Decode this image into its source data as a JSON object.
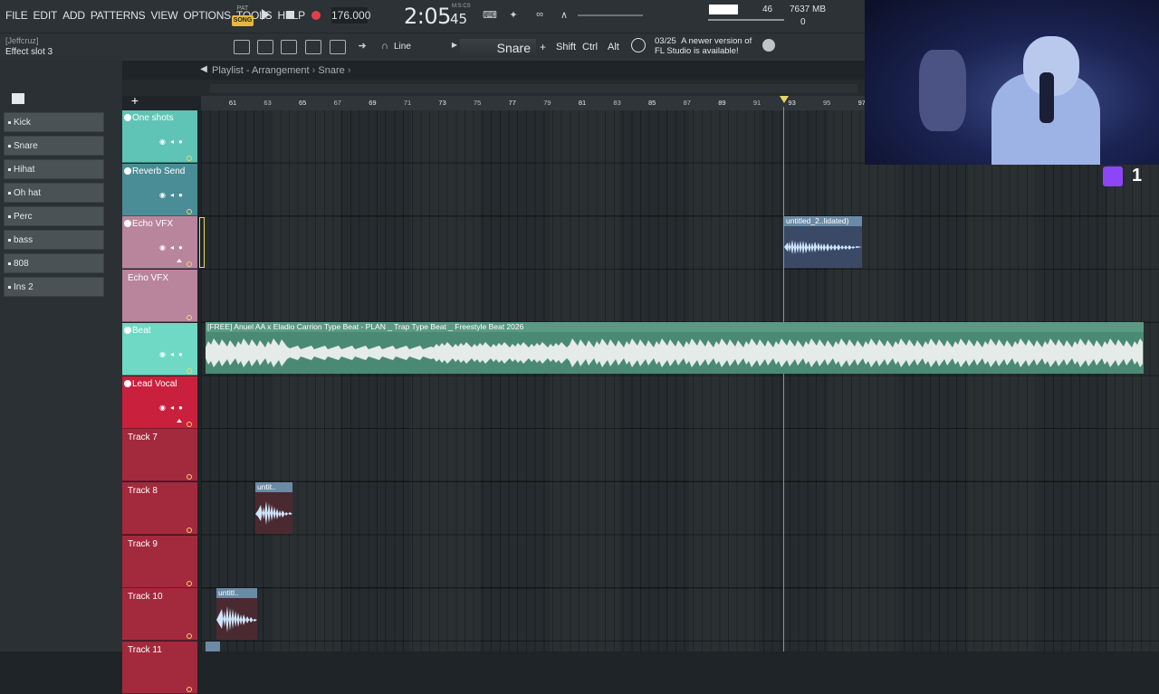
{
  "menu": [
    "FILE",
    "EDIT",
    "ADD",
    "PATTERNS",
    "VIEW",
    "OPTIONS",
    "TOOLS",
    "HELP"
  ],
  "transport": {
    "pat_label": "PAT",
    "song_label": "SONG",
    "bpm": "176.000",
    "time_main": "2:05",
    "time_sub": "45",
    "time_format": "M:S:CS"
  },
  "status": {
    "cpu": "46",
    "memory": "7637 MB",
    "polyphony": "0"
  },
  "hint": {
    "user": "[Jeffcruz]",
    "text": "Effect slot 3"
  },
  "toolbar": {
    "snap_mode": "Line",
    "snap_value": "Snare",
    "plus": "+",
    "shift": "Shift",
    "ctrl": "Ctrl",
    "alt": "Alt",
    "news_date": "03/25",
    "news_line1": "A newer version of",
    "news_line2": "FL Studio is available!"
  },
  "playlist": {
    "title": "Playlist - Arrangement",
    "pattern": "Snare"
  },
  "channels": [
    "Kick",
    "Snare",
    "Hihat",
    "Oh hat",
    "Perc",
    "bass",
    "808",
    "Ins 2"
  ],
  "ruler_ticks": [
    "61",
    "63",
    "65",
    "67",
    "69",
    "71",
    "73",
    "75",
    "77",
    "79",
    "81",
    "83",
    "85",
    "87",
    "89",
    "91",
    "93",
    "95",
    "97"
  ],
  "tracks": [
    {
      "name": "One shots",
      "color": "#5fc4b6"
    },
    {
      "name": "Reverb Send",
      "color": "#4a8d96"
    },
    {
      "name": "Echo VFX",
      "color": "#b9859c"
    },
    {
      "name": "Echo VFX",
      "color": "#b9859c"
    },
    {
      "name": "Beat",
      "color": "#6fd9c5"
    },
    {
      "name": "Lead Vocal",
      "color": "#c9213d"
    },
    {
      "name": "Track 7",
      "color": "#a3293d"
    },
    {
      "name": "Track 8",
      "color": "#a3293d"
    },
    {
      "name": "Track 9",
      "color": "#a3293d"
    },
    {
      "name": "Track 10",
      "color": "#a3293d"
    },
    {
      "name": "Track 11",
      "color": "#a3293d"
    }
  ],
  "clips": {
    "echo": "untitled_2..lidated)",
    "beat": "[FREE] Anuel AA x Eladio Carrion Type Beat - PLAN _ Trap Type Beat _ Freestyle  Beat 2026",
    "track8": "untit..",
    "track10": "untitl.."
  },
  "twitch_count": "1",
  "colors": {
    "accent": "#e8b640",
    "record": "#e0404b",
    "twitch": "#8c45f7"
  }
}
